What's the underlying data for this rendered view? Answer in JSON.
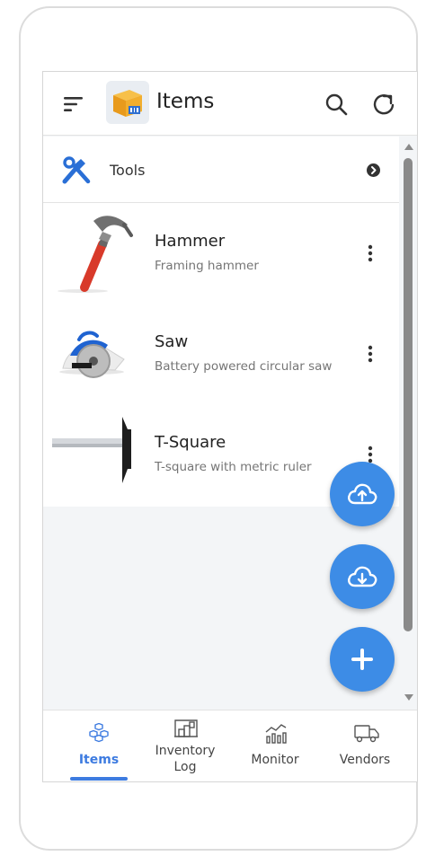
{
  "app_bar": {
    "title": "Items",
    "menu_icon": "menu-icon",
    "logo_icon": "box-logo-icon",
    "search_icon": "search-icon",
    "refresh_icon": "refresh-icon"
  },
  "category": {
    "label": "Tools",
    "icon": "tools-icon",
    "expand_icon": "chevron-right-icon"
  },
  "items": [
    {
      "name": "Hammer",
      "description": "Framing hammer",
      "thumb_icon": "hammer-icon"
    },
    {
      "name": "Saw",
      "description": "Battery powered circular saw",
      "thumb_icon": "circular-saw-icon"
    },
    {
      "name": "T-Square",
      "description": "T-square with metric ruler",
      "thumb_icon": "t-square-icon"
    }
  ],
  "fabs": {
    "upload_icon": "cloud-upload-icon",
    "download_icon": "cloud-download-icon",
    "add_icon": "plus-icon"
  },
  "bottom_nav": [
    {
      "label": "Items",
      "icon": "cubes-icon",
      "active": true
    },
    {
      "label": "Inventory\nLog",
      "icon": "warehouse-icon",
      "active": false
    },
    {
      "label": "Monitor",
      "icon": "chart-icon",
      "active": false
    },
    {
      "label": "Vendors",
      "icon": "truck-icon",
      "active": false
    }
  ],
  "colors": {
    "accent": "#3d8ce6",
    "nav_active": "#3d7be0",
    "background": "#f3f5f7"
  }
}
